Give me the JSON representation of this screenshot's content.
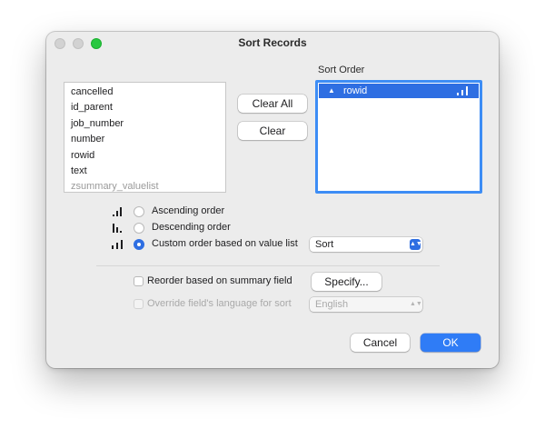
{
  "window": {
    "title": "Sort Records"
  },
  "fields": [
    {
      "name": "cancelled",
      "dimmed": false
    },
    {
      "name": "id_parent",
      "dimmed": false
    },
    {
      "name": "job_number",
      "dimmed": false
    },
    {
      "name": "number",
      "dimmed": false
    },
    {
      "name": "rowid",
      "dimmed": false
    },
    {
      "name": "text",
      "dimmed": false
    },
    {
      "name": "zsummary_valuelist",
      "dimmed": true
    }
  ],
  "buttons": {
    "clear_all": "Clear All",
    "clear": "Clear",
    "specify": "Specify...",
    "cancel": "Cancel",
    "ok": "OK"
  },
  "sort_order": {
    "label": "Sort Order",
    "items": [
      {
        "field": "rowid",
        "order": "custom",
        "icon": "custom-order-icon"
      }
    ]
  },
  "order_options": [
    {
      "label": "Ascending order",
      "icon": "ascending-order-icon",
      "selected": false
    },
    {
      "label": "Descending order",
      "icon": "descending-order-icon",
      "selected": false
    },
    {
      "label": "Custom order based on value list",
      "icon": "custom-order-icon",
      "selected": true
    }
  ],
  "value_list_popup": {
    "value": "Sort"
  },
  "reorder_summary": {
    "label": "Reorder based on summary field",
    "checked": false
  },
  "override_language": {
    "label": "Override field's language for sort",
    "checked": false,
    "enabled": false
  },
  "language_popup": {
    "value": "English"
  },
  "colors": {
    "accent": "#2e6ee2",
    "selection_border": "#3d8df5",
    "ok_button": "#2f7cf6",
    "zoom_button": "#28c840"
  }
}
